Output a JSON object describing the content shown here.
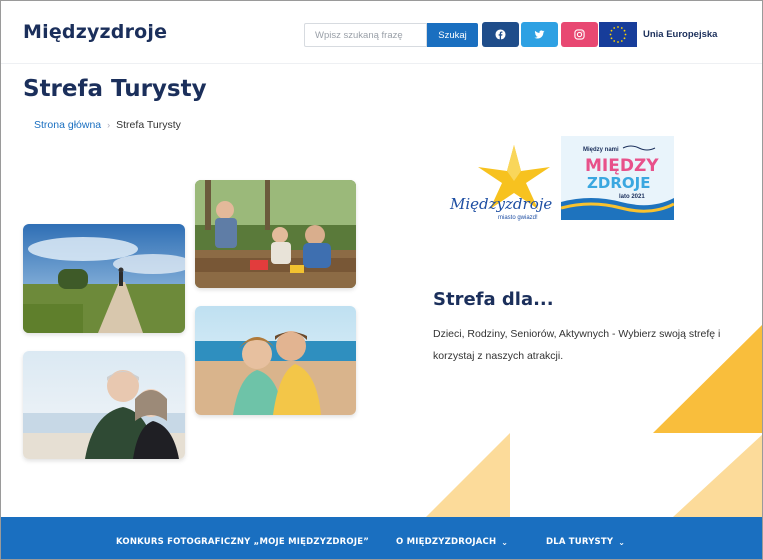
{
  "header": {
    "logo": "Międzyzdroje",
    "search": {
      "placeholder": "Wpisz szukaną frazę",
      "button_label": "Szukaj"
    },
    "social": [
      "facebook-icon",
      "twitter-icon",
      "instagram-icon"
    ],
    "eu_label": "Unia Europejska"
  },
  "page": {
    "title": "Strefa Turysty",
    "breadcrumb": {
      "home": "Strona główna",
      "separator": "›",
      "current": "Strefa Turysty"
    }
  },
  "section": {
    "title": "Strefa dla...",
    "text": "Dzieci, Rodziny, Seniorów, Aktywnych - Wybierz swoją strefę i korzystaj z naszych atrakcji."
  },
  "logos": {
    "star_logo_text": "Międzyzdroje",
    "star_logo_sub": "miasto gwiazd!",
    "lato_top": "Między nami",
    "lato_word1": "MIĘDZY",
    "lato_word2": "ZDROJE",
    "lato_bottom": "lato 2021"
  },
  "bottom_nav": {
    "items": [
      {
        "label": "KONKURS FOTOGRAFICZNY „MOJE MIĘDZYZDROJE”",
        "has_dropdown": false
      },
      {
        "label": "O MIĘDZYZDROJACH",
        "has_dropdown": true
      },
      {
        "label": "DLA TURYSTY",
        "has_dropdown": true
      }
    ]
  },
  "colors": {
    "brand_navy": "#1b2f5b",
    "brand_blue": "#1a6fc0",
    "facebook": "#1f4d8a",
    "twitter": "#2ea1e3",
    "instagram": "#e84872",
    "accent_yellow": "#f9be3c"
  }
}
